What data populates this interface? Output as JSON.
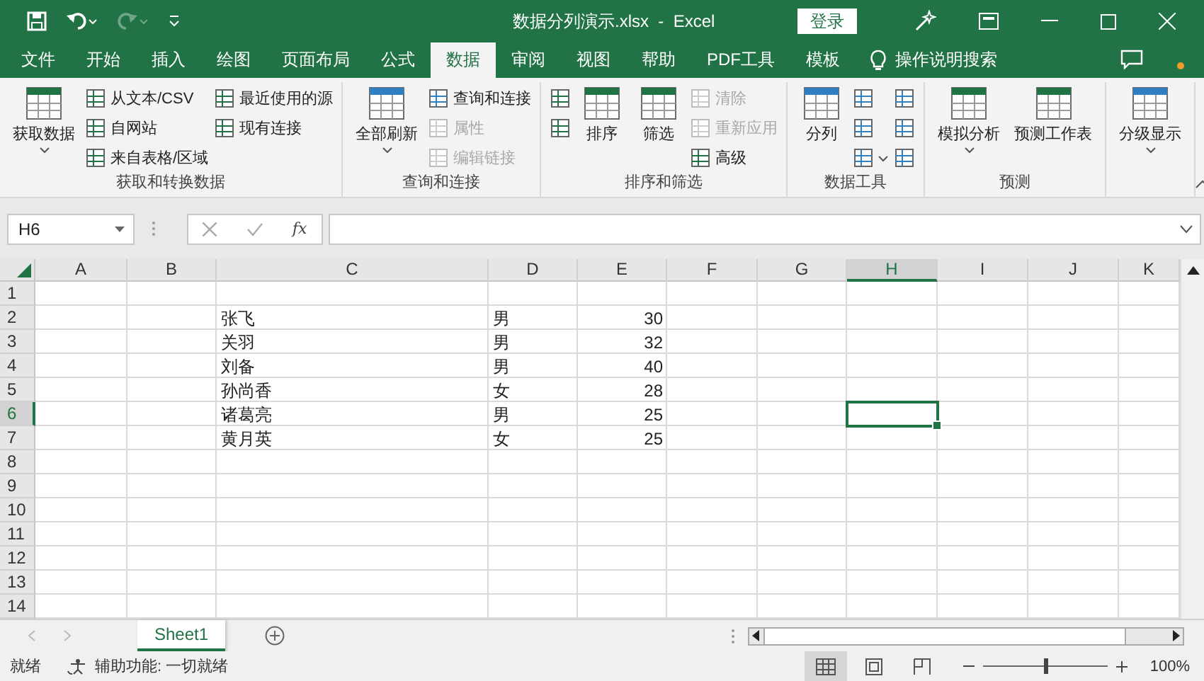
{
  "title_bar": {
    "title": "数据分列演示.xlsx  -  Excel",
    "login": "登录"
  },
  "menu_tabs": [
    {
      "label": "文件",
      "selected": false
    },
    {
      "label": "开始",
      "selected": false
    },
    {
      "label": "插入",
      "selected": false
    },
    {
      "label": "绘图",
      "selected": false
    },
    {
      "label": "页面布局",
      "selected": false
    },
    {
      "label": "公式",
      "selected": false
    },
    {
      "label": "数据",
      "selected": true
    },
    {
      "label": "审阅",
      "selected": false
    },
    {
      "label": "视图",
      "selected": false
    },
    {
      "label": "帮助",
      "selected": false
    },
    {
      "label": "PDF工具",
      "selected": false
    },
    {
      "label": "模板",
      "selected": false
    }
  ],
  "tell_me": "操作说明搜索",
  "ribbon_groups": [
    {
      "label": "获取和转换数据",
      "columns": [
        [
          {
            "kind": "large",
            "label": "获取数据",
            "dropdown": true,
            "disabled": false
          }
        ],
        [
          {
            "kind": "small",
            "label": "从文本/CSV",
            "disabled": false
          },
          {
            "kind": "small",
            "label": "自网站",
            "disabled": false
          },
          {
            "kind": "small",
            "label": "来自表格/区域",
            "disabled": false
          }
        ],
        [
          {
            "kind": "small",
            "label": "最近使用的源",
            "disabled": false
          },
          {
            "kind": "small",
            "label": "现有连接",
            "disabled": false
          }
        ]
      ]
    },
    {
      "label": "查询和连接",
      "columns": [
        [
          {
            "kind": "large",
            "label": "全部刷新",
            "dropdown": true,
            "disabled": false
          }
        ],
        [
          {
            "kind": "small",
            "label": "查询和连接",
            "disabled": false
          },
          {
            "kind": "small",
            "label": "属性",
            "disabled": true
          },
          {
            "kind": "small",
            "label": "编辑链接",
            "disabled": true
          }
        ]
      ]
    },
    {
      "label": "排序和筛选",
      "columns": [
        [
          {
            "kind": "small",
            "disabled": false
          },
          {
            "kind": "small",
            "disabled": false
          }
        ],
        [
          {
            "kind": "large",
            "label": "排序",
            "disabled": false
          }
        ],
        [
          {
            "kind": "large",
            "label": "筛选",
            "disabled": false
          }
        ],
        [
          {
            "kind": "small",
            "label": "清除",
            "disabled": true
          },
          {
            "kind": "small",
            "label": "重新应用",
            "disabled": true
          },
          {
            "kind": "small",
            "label": "高级",
            "disabled": false
          }
        ]
      ]
    },
    {
      "label": "数据工具",
      "columns": [
        [
          {
            "kind": "large",
            "label": "分列",
            "disabled": false
          }
        ],
        [
          {
            "kind": "small",
            "disabled": false
          },
          {
            "kind": "small",
            "disabled": false
          },
          {
            "kind": "small",
            "dropdown": true,
            "disabled": false
          }
        ],
        [
          {
            "kind": "small",
            "disabled": false
          },
          {
            "kind": "small",
            "disabled": false
          },
          {
            "kind": "small",
            "disabled": false
          }
        ]
      ]
    },
    {
      "label": "预测",
      "columns": [
        [
          {
            "kind": "large",
            "label": "模拟分析",
            "dropdown": true,
            "disabled": false
          }
        ],
        [
          {
            "kind": "large",
            "label": "预测工作表",
            "disabled": false
          }
        ]
      ]
    },
    {
      "columns": [
        [
          {
            "kind": "large",
            "label": "分级显示",
            "dropdown": true,
            "disabled": false
          }
        ]
      ]
    }
  ],
  "formula_bar": {
    "name_box": "H6",
    "fx": "fx"
  },
  "columns": [
    {
      "label": "A",
      "selected": false
    },
    {
      "label": "B",
      "selected": false
    },
    {
      "label": "C",
      "selected": false
    },
    {
      "label": "D",
      "selected": false
    },
    {
      "label": "E",
      "selected": false
    },
    {
      "label": "F",
      "selected": false
    },
    {
      "label": "G",
      "selected": false
    },
    {
      "label": "H",
      "selected": true
    },
    {
      "label": "I",
      "selected": false
    },
    {
      "label": "J",
      "selected": false
    },
    {
      "label": "K",
      "selected": false
    }
  ],
  "rows": [
    {
      "label": "1",
      "selected": false
    },
    {
      "label": "2",
      "selected": false,
      "cells": [
        null,
        null,
        {
          "text": "张飞",
          "kind": "text"
        },
        {
          "text": "男",
          "kind": "text"
        },
        {
          "text": "30",
          "kind": "number"
        }
      ]
    },
    {
      "label": "3",
      "selected": false,
      "cells": [
        null,
        null,
        {
          "text": "关羽",
          "kind": "text"
        },
        {
          "text": "男",
          "kind": "text"
        },
        {
          "text": "32",
          "kind": "number"
        }
      ]
    },
    {
      "label": "4",
      "selected": false,
      "cells": [
        null,
        null,
        {
          "text": "刘备",
          "kind": "text"
        },
        {
          "text": "男",
          "kind": "text"
        },
        {
          "text": "40",
          "kind": "number"
        }
      ]
    },
    {
      "label": "5",
      "selected": false,
      "cells": [
        null,
        null,
        {
          "text": "孙尚香",
          "kind": "text"
        },
        {
          "text": "女",
          "kind": "text"
        },
        {
          "text": "28",
          "kind": "number"
        }
      ]
    },
    {
      "label": "6",
      "selected": true,
      "cells": [
        null,
        null,
        {
          "text": "诸葛亮",
          "kind": "text"
        },
        {
          "text": "男",
          "kind": "text"
        },
        {
          "text": "25",
          "kind": "number"
        }
      ]
    },
    {
      "label": "7",
      "selected": false,
      "cells": [
        null,
        null,
        {
          "text": "黄月英",
          "kind": "text"
        },
        {
          "text": "女",
          "kind": "text"
        },
        {
          "text": "25",
          "kind": "number"
        }
      ]
    },
    {
      "label": "8",
      "selected": false
    },
    {
      "label": "9",
      "selected": false
    },
    {
      "label": "10",
      "selected": false
    },
    {
      "label": "11",
      "selected": false
    },
    {
      "label": "12",
      "selected": false
    },
    {
      "label": "13",
      "selected": false
    },
    {
      "label": "14",
      "selected": false
    }
  ],
  "sheet_tabs": [
    {
      "label": "Sheet1",
      "selected": true
    }
  ],
  "status_bar": {
    "status": "就绪",
    "accessibility": "辅助功能: 一切就绪",
    "views": [
      {
        "kind": "normal",
        "selected": true
      },
      {
        "kind": "page_layout",
        "selected": false
      },
      {
        "kind": "page_break",
        "selected": false
      }
    ],
    "zoom": {
      "level": 0.5,
      "reading": "100%"
    }
  }
}
